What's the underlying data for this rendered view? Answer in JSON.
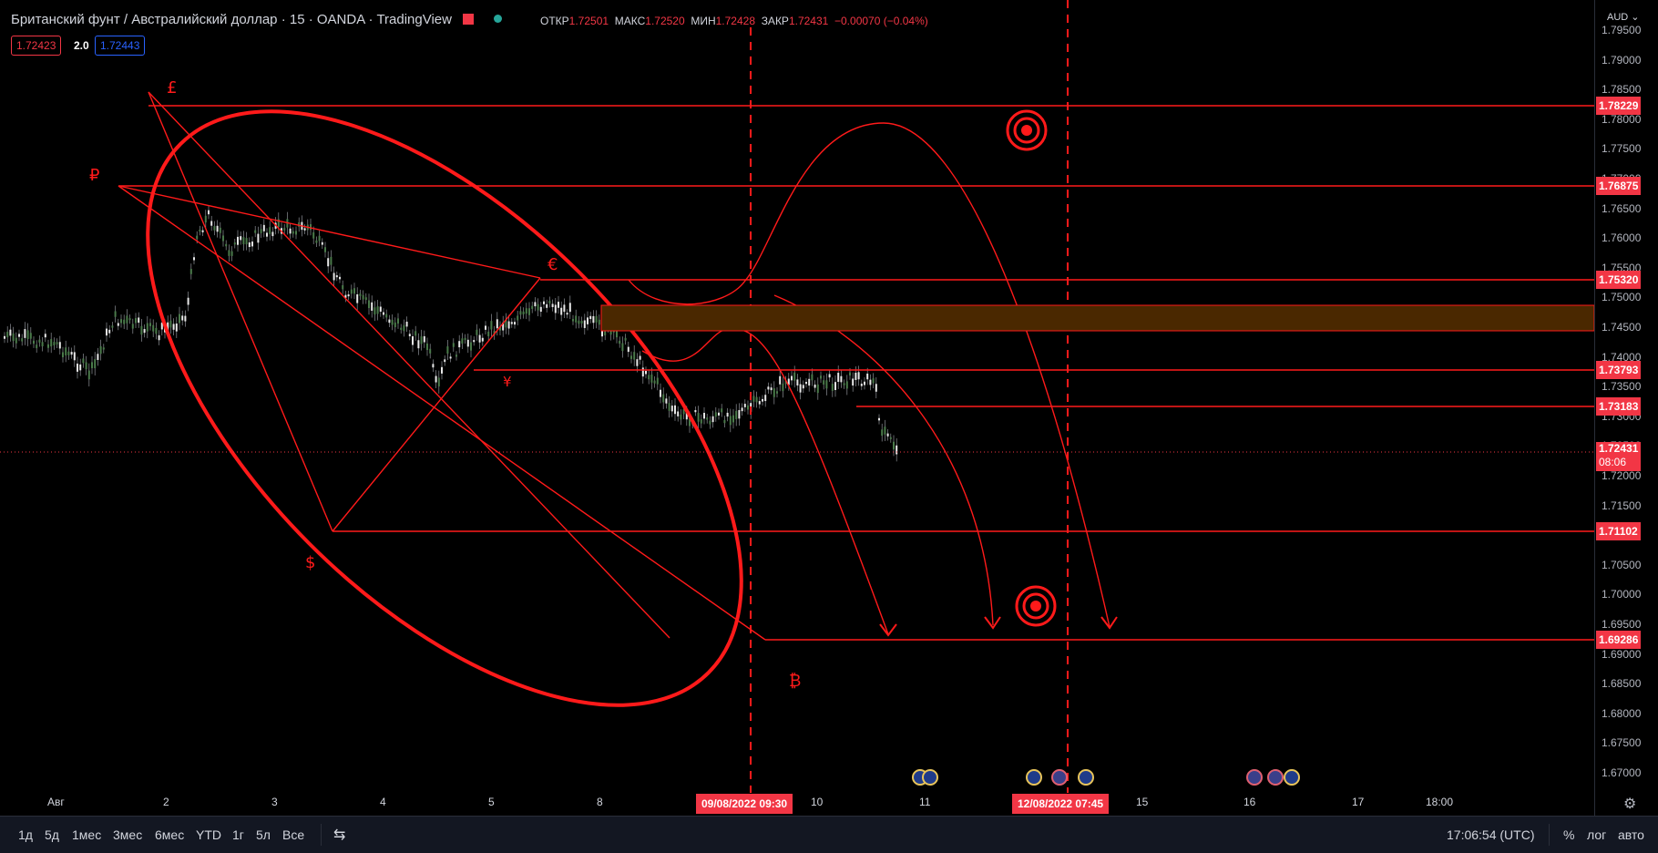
{
  "header": {
    "title": "Британский фунт / Австралийский доллар · 15 · OANDA · TradingView",
    "ohlc": [
      {
        "label": "ОТКР",
        "value": "1.72501"
      },
      {
        "label": "МАКС",
        "value": "1.72520"
      },
      {
        "label": "МИН",
        "value": "1.72428"
      },
      {
        "label": "ЗАКР",
        "value": "1.72431"
      },
      {
        "label": "",
        "value": "−0.00070 (−0.04%)"
      }
    ],
    "bid": "1.72423",
    "spread": "2.0",
    "ask": "1.72443"
  },
  "currency_menu": "AUD",
  "price_axis": {
    "labels": [
      "1.79500",
      "1.79000",
      "1.78500",
      "1.78000",
      "1.77500",
      "1.77000",
      "1.76500",
      "1.76000",
      "1.75500",
      "1.75000",
      "1.74500",
      "1.74000",
      "1.73500",
      "1.73000",
      "1.72500",
      "1.72000",
      "1.71500",
      "1.71000",
      "1.70500",
      "1.70000",
      "1.69500",
      "1.69000",
      "1.68500",
      "1.68000",
      "1.67500",
      "1.67000"
    ]
  },
  "levels": [
    {
      "price": "1.78229"
    },
    {
      "price": "1.76875"
    },
    {
      "price": "1.75320"
    },
    {
      "price": "1.73793"
    },
    {
      "price": "1.73183"
    },
    {
      "price": "1.71102"
    },
    {
      "price": "1.69286"
    }
  ],
  "current_price": {
    "price": "1.72431",
    "countdown": "08:06"
  },
  "time_axis": [
    "Авг",
    "2",
    "3",
    "4",
    "5",
    "8",
    "10",
    "11",
    "15",
    "16",
    "17",
    "18:00"
  ],
  "vertical_markers": [
    {
      "label": "09/08/2022   09:30"
    },
    {
      "label": "12/08/2022   07:45"
    }
  ],
  "symbols": [
    "£",
    "₽",
    "€",
    "¥",
    "$",
    "₿"
  ],
  "bottom_bar": {
    "ranges": [
      "1д",
      "5д",
      "1мес",
      "3мес",
      "6мес",
      "YTD",
      "1г",
      "5л",
      "Все"
    ],
    "time": "17:06:54 (UTC)",
    "options": [
      "%",
      "лог",
      "авто"
    ]
  },
  "colors": {
    "drawing": "#ff1a1a",
    "label_bg": "#f23645",
    "zone": "#4a2800",
    "background": "#000000"
  }
}
